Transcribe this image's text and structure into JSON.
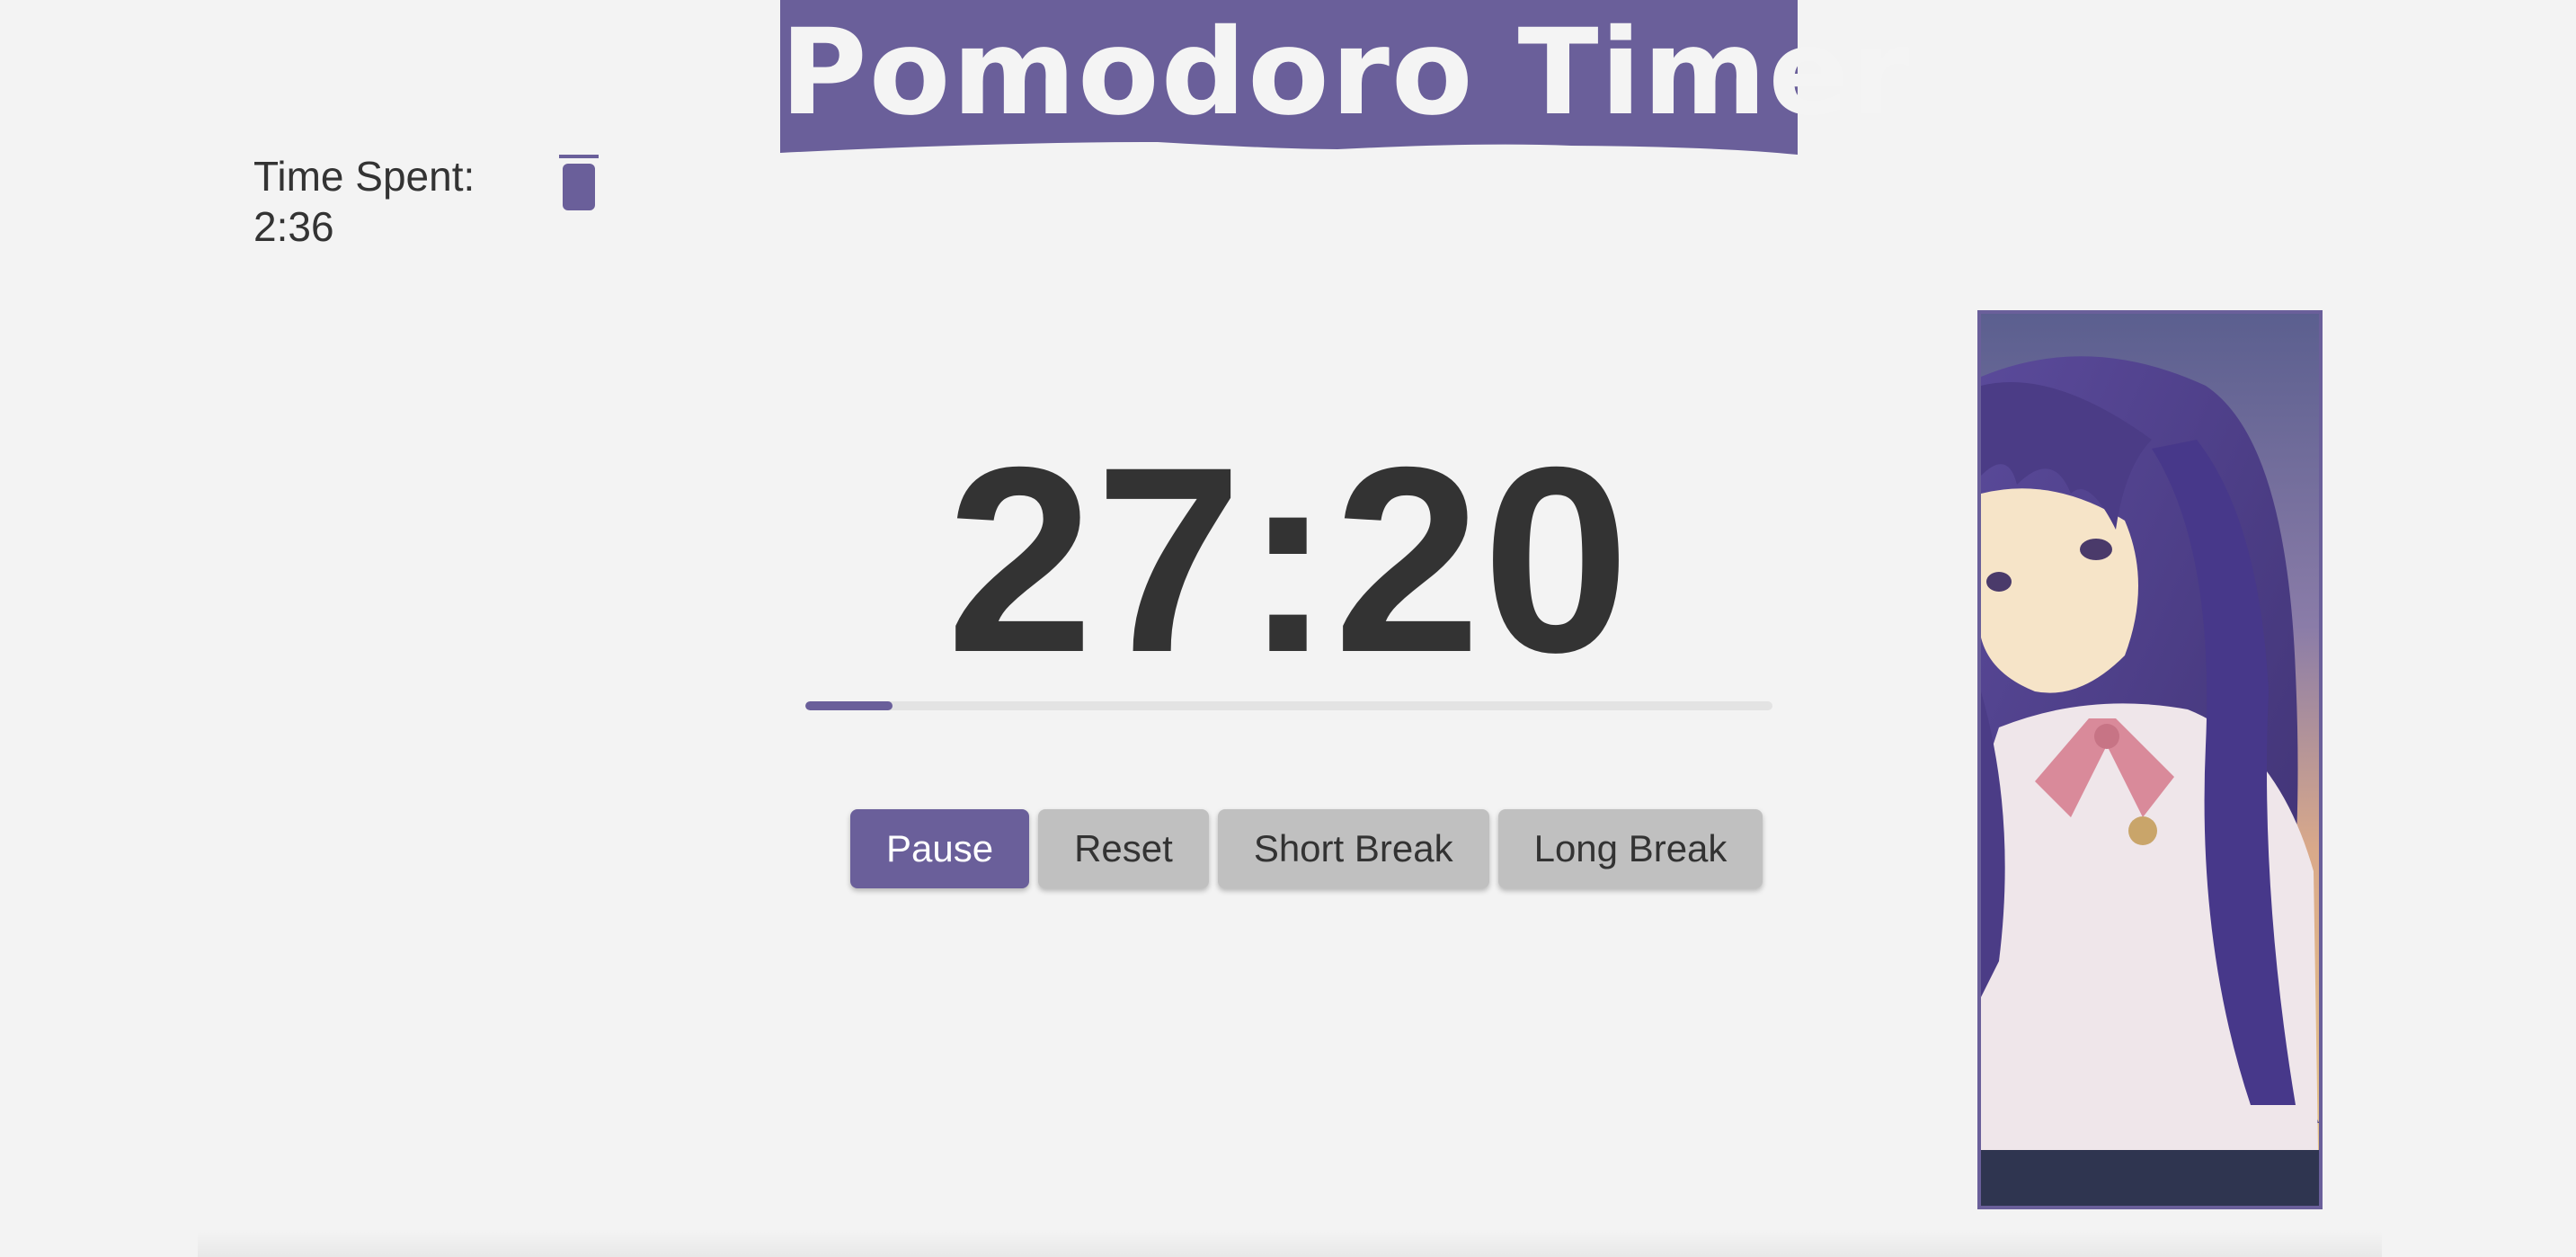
{
  "app": {
    "title": "Pomodoro Timer"
  },
  "stats": {
    "time_spent_label": "Time Spent:",
    "time_spent_value": "2:36"
  },
  "timer": {
    "display": "27:20",
    "progress_fraction": 0.09
  },
  "controls": {
    "pause_label": "Pause",
    "reset_label": "Reset",
    "short_break_label": "Short Break",
    "long_break_label": "Long Break"
  },
  "icons": {
    "clear": "trash-icon"
  },
  "colors": {
    "accent": "#6a5f9a",
    "background": "#f3f3f3",
    "text": "#333333",
    "button_secondary": "#c0c0c0"
  }
}
